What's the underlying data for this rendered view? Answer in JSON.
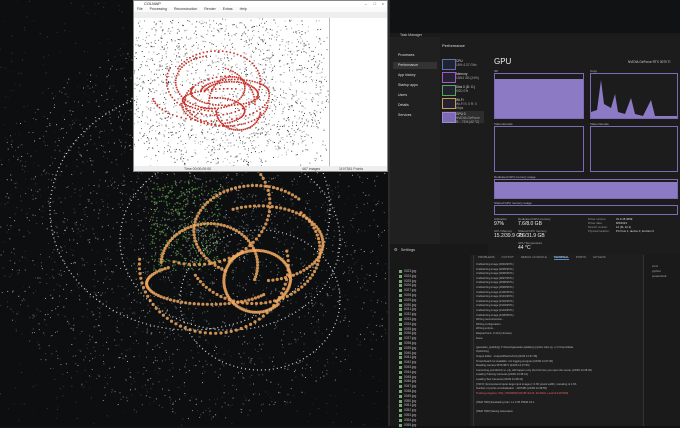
{
  "colmap": {
    "title": "COLMAP",
    "menu": [
      "File",
      "Processing",
      "Reconstruction",
      "Render",
      "Extras",
      "Help"
    ],
    "status_left": "Time 00:00:00:00",
    "status_mid": "467 images",
    "status_right": "1197381 Points"
  },
  "taskmgr": {
    "title": "Task Manager",
    "section": "Performance",
    "nav": [
      "Processes",
      "Performance",
      "App history",
      "Startup apps",
      "Users",
      "Details",
      "Services"
    ],
    "settings": "Settings",
    "devices": [
      {
        "name": "CPU",
        "sub": "16% 4.37 GHz"
      },
      {
        "name": "Memory",
        "sub": "15/64 GB (24%)"
      },
      {
        "name": "Disk 0 (D: C:)",
        "sub": "SSD 0%"
      },
      {
        "name": "Wi-Fi",
        "sub": "Wi-Fi S: 0 R: 0 Kbps"
      },
      {
        "name": "GPU 0",
        "sub": "NVIDIA GeForce R... 71% (42 °C)"
      }
    ],
    "gpu_title": "GPU",
    "gpu_model": "NVIDIA GeForce RTX 3070 Ti",
    "graph_labels": [
      "3D",
      "Copy",
      "Video Encode",
      "Video Decode"
    ],
    "mem_label": "Dedicated GPU memory usage",
    "shared_label": "Shared GPU memory usage",
    "stats": {
      "util_label": "Utilization",
      "util": "97%",
      "ded_label": "Dedicated GPU memory",
      "ded": "7.6/8.0 GB",
      "gpu_mem_label": "GPU Memory",
      "gpu_mem": "15.2/39.9 GB",
      "shared_label": "Shared GPU memory",
      "shared": "7.6/31.9 GB",
      "temp_label": "GPU Temperature",
      "temp": "44 °C",
      "driver_version": "31.0.15.3699",
      "driver_date": "8/8/2023",
      "directx": "12 (FL 12.1)",
      "location": "PCI bus 1, device 0, function 0"
    }
  },
  "vscode": {
    "tabs": [
      "PROBLEMS",
      "OUTPUT",
      "DEBUG CONSOLE",
      "TERMINAL",
      "PORTS",
      "GITLENS"
    ],
    "active_tab": "TERMINAL",
    "files": [
      "0023.jpg",
      "0024.jpg",
      "0025.jpg",
      "0026.jpg",
      "0027.jpg",
      "0028.jpg",
      "0029.jpg",
      "0030.jpg",
      "0031.jpg",
      "0032.jpg",
      "0033.jpg",
      "0034.jpg",
      "0035.jpg",
      "0036.jpg",
      "0037.jpg",
      "0038.jpg",
      "0039.jpg",
      "0040.jpg",
      "0041.jpg",
      "0042.jpg",
      "0043.jpg",
      "0044.jpg",
      "0045.jpg",
      "0046.jpg",
      "0047.jpg",
      "0048.jpg",
      "0049.jpg",
      "0050.jpg",
      "0051.jpg",
      "0052.jpg",
      "0053.jpg",
      "0054.jpg",
      "0055.jpg"
    ],
    "log": [
      "Undistorting image [3094/3671]",
      "Undistorting image [3095/3671]",
      "Undistorting image [3096/3671]",
      "Undistorting image [3097/3671]",
      "Undistorting image [3098/3671]",
      "Undistorting image [3099/3671]",
      "Undistorting image [3100/3671]",
      "Undistorting image [3101/3671]",
      "Undistorting image [3102/3671]",
      "Undistorting image [3103/3671]",
      "Undistorting image [3104/3671]",
      "Undistorting image [3105/3671]",
      "Writing reconstruction...",
      "Writing configuration...",
      "Writing scripts...",
      "Elapsed time: 0.414 [minutes]",
      "Done.",
      "",
      "(gaussian_splatting) C:\\Users\\gaussian-splatting>python train.py -s C:\\Users\\data",
      "Optimizing",
      "Output folder: ./output/d5e2ca7d-6 [24/09 14:37:46]",
      "Tensorboard not available: not logging progress [24/09 14:37:46]",
      "Reading camera 3671/3671 [24/09 14:37:50]",
      "Converting point3d.bin to .ply, will happen only the first time you open the scene. [24/09 14:38:40]",
      "Loading Training Cameras [24/09 14:38:41]",
      "Loading Test Cameras [24/09 14:38:41]",
      "[ INFO ] Encountered quite large input images (>1.6K pixels width), rescaling to 1.6K.",
      "Number of points at initialisation : 1197381 [24/09 14:38:55]",
      "Training progress:  2%|  | 700/30000 [00:35<24:10, 20.20it/s, Loss=0.1437263]",
      "",
      "[ITER 7000] Evaluating train: L1 0.05 PSNR 23.1",
      "",
      "[ITER 7000] Saving Gaussians"
    ],
    "right_panel": [
      "cmd",
      "python",
      "powershell"
    ],
    "settings_label": "Settings"
  }
}
